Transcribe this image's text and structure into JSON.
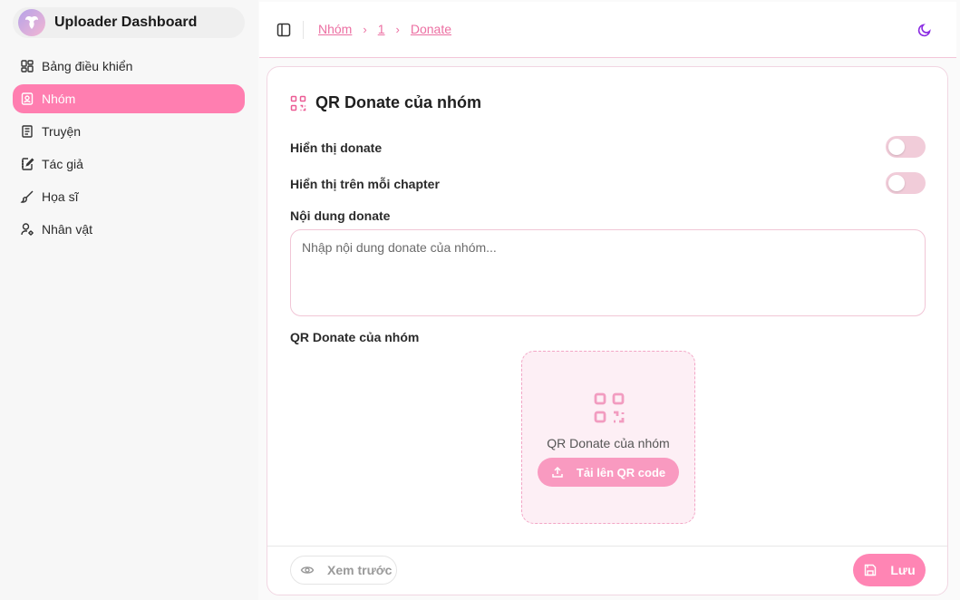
{
  "app": {
    "title": "Uploader Dashboard",
    "logo_icon": "angel-logo"
  },
  "sidebar": {
    "items": [
      {
        "label": "Bảng điều khiển",
        "icon": "dashboard-grid-icon",
        "active": false
      },
      {
        "label": "Nhóm",
        "icon": "contact-card-icon",
        "active": true
      },
      {
        "label": "Truyện",
        "icon": "book-icon",
        "active": false
      },
      {
        "label": "Tác giả",
        "icon": "notebook-pen-icon",
        "active": false
      },
      {
        "label": "Họa sĩ",
        "icon": "brush-icon",
        "active": false
      },
      {
        "label": "Nhân vật",
        "icon": "user-cog-icon",
        "active": false
      }
    ]
  },
  "breadcrumb": [
    "Nhóm",
    "1",
    "Donate"
  ],
  "card": {
    "title": "QR Donate của nhóm",
    "show_donate_label": "Hiển thị donate",
    "show_donate_on": false,
    "show_each_chapter_label": "Hiển thị trên mỗi chapter",
    "show_each_chapter_on": false,
    "content_label": "Nội dung donate",
    "content_placeholder": "Nhập nội dung donate của nhóm...",
    "content_value": "",
    "qr_label": "QR Donate của nhóm",
    "upload_text": "QR Donate của nhóm",
    "upload_button": "Tải lên QR code",
    "preview_button": "Xem trước",
    "save_button": "Lưu"
  },
  "colors": {
    "accent": "#ff7eb0",
    "accent_light": "#fdeff5",
    "switch_off": "#f1ccd9",
    "moon": "#8a2be2"
  }
}
